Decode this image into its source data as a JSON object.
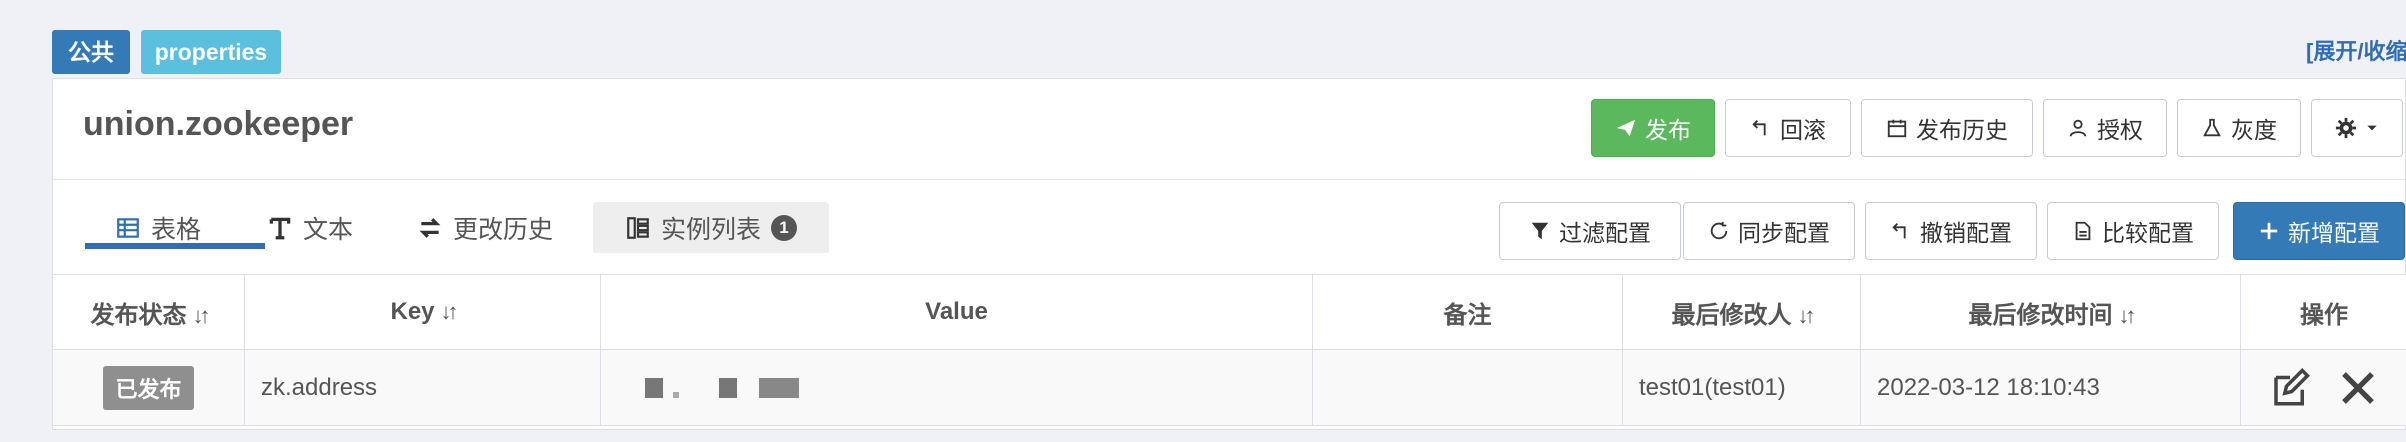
{
  "env_tag": "公共",
  "namespace_tag": "properties",
  "expand_link": "[展开/收缩]",
  "namespace_title": "union.zookeeper",
  "header_buttons": {
    "publish": "发布",
    "rollback": "回滚",
    "history": "发布历史",
    "authorize": "授权",
    "gray": "灰度"
  },
  "tabs": {
    "table": "表格",
    "text": "文本",
    "change_history": "更改历史",
    "instances": "实例列表",
    "instances_count": "1"
  },
  "toolbar": {
    "filter": "过滤配置",
    "sync": "同步配置",
    "revoke": "撤销配置",
    "compare": "比较配置",
    "add": "新增配置"
  },
  "table": {
    "headers": {
      "status": "发布状态",
      "key": "Key",
      "value": "Value",
      "comment": "备注",
      "modifier": "最后修改人",
      "modified_time": "最后修改时间",
      "ops": "操作"
    },
    "rows": [
      {
        "status": "已发布",
        "key": "zk.address",
        "value": "",
        "comment": "",
        "modifier": "test01(test01)",
        "modified_time": "2022-03-12 18:10:43"
      }
    ]
  },
  "colors": {
    "primary": "#337ab7",
    "info": "#5bc0de",
    "success": "#5cb85c",
    "status_gray": "#8f8f8f"
  }
}
